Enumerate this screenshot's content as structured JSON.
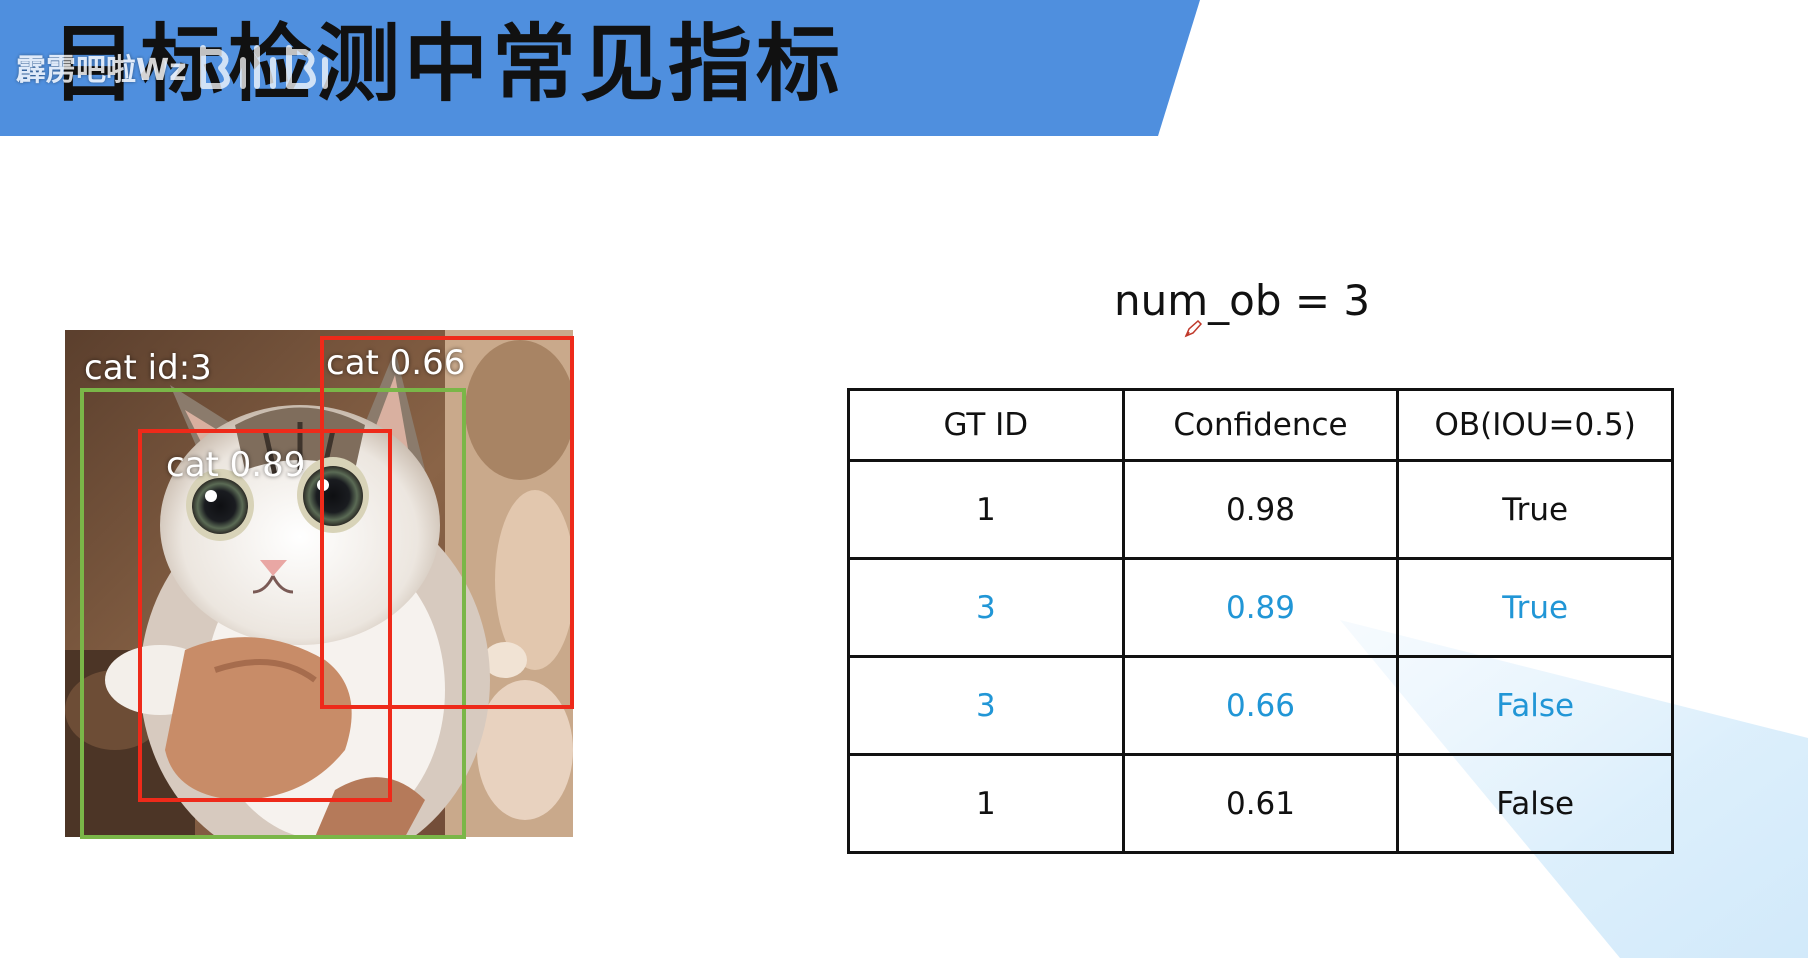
{
  "header": {
    "title": "目标检测中常见指标",
    "banner_color": "#4f8fde",
    "watermark_name": "霹雳吧啦Wz",
    "watermark_logo": "bilibili-logo-icon"
  },
  "photo": {
    "subject": "cat-photo",
    "labels": {
      "ground_truth": "cat id:3",
      "prediction_a": "cat 0.66",
      "prediction_b": "cat 0.89"
    },
    "colors": {
      "ground_truth_box": "#7ab648",
      "prediction_box": "#ee2a1a"
    }
  },
  "num_ob": "num_ob = 3",
  "table": {
    "headers": [
      "GT ID",
      "Confidence",
      "OB(IOU=0.5)"
    ],
    "rows": [
      {
        "gt_id": "1",
        "confidence": "0.98",
        "ob": "True",
        "highlight": false
      },
      {
        "gt_id": "3",
        "confidence": "0.89",
        "ob": "True",
        "highlight": true
      },
      {
        "gt_id": "3",
        "confidence": "0.66",
        "ob": "False",
        "highlight": true
      },
      {
        "gt_id": "1",
        "confidence": "0.61",
        "ob": "False",
        "highlight": false
      }
    ],
    "highlight_color": "#2196d6"
  },
  "cursor_icon": "pen-cursor-icon"
}
